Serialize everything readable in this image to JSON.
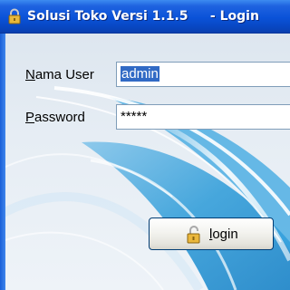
{
  "window": {
    "title": "Solusi Toko Versi 1.1.5     - Login",
    "title_icon": "lock-icon"
  },
  "form": {
    "username_label_mnemonic": "N",
    "username_label_rest": "ama User",
    "username_value": "admin",
    "password_label_mnemonic": "P",
    "password_label_rest": "assword",
    "password_value": "*****"
  },
  "login_button": {
    "label_mnemonic": "l",
    "label_rest": "ogin",
    "icon": "unlocked-padlock-icon"
  },
  "colors": {
    "title_bar": "#0a52d8",
    "selection": "#316ac5",
    "background_wave": "#1c8fd0"
  }
}
